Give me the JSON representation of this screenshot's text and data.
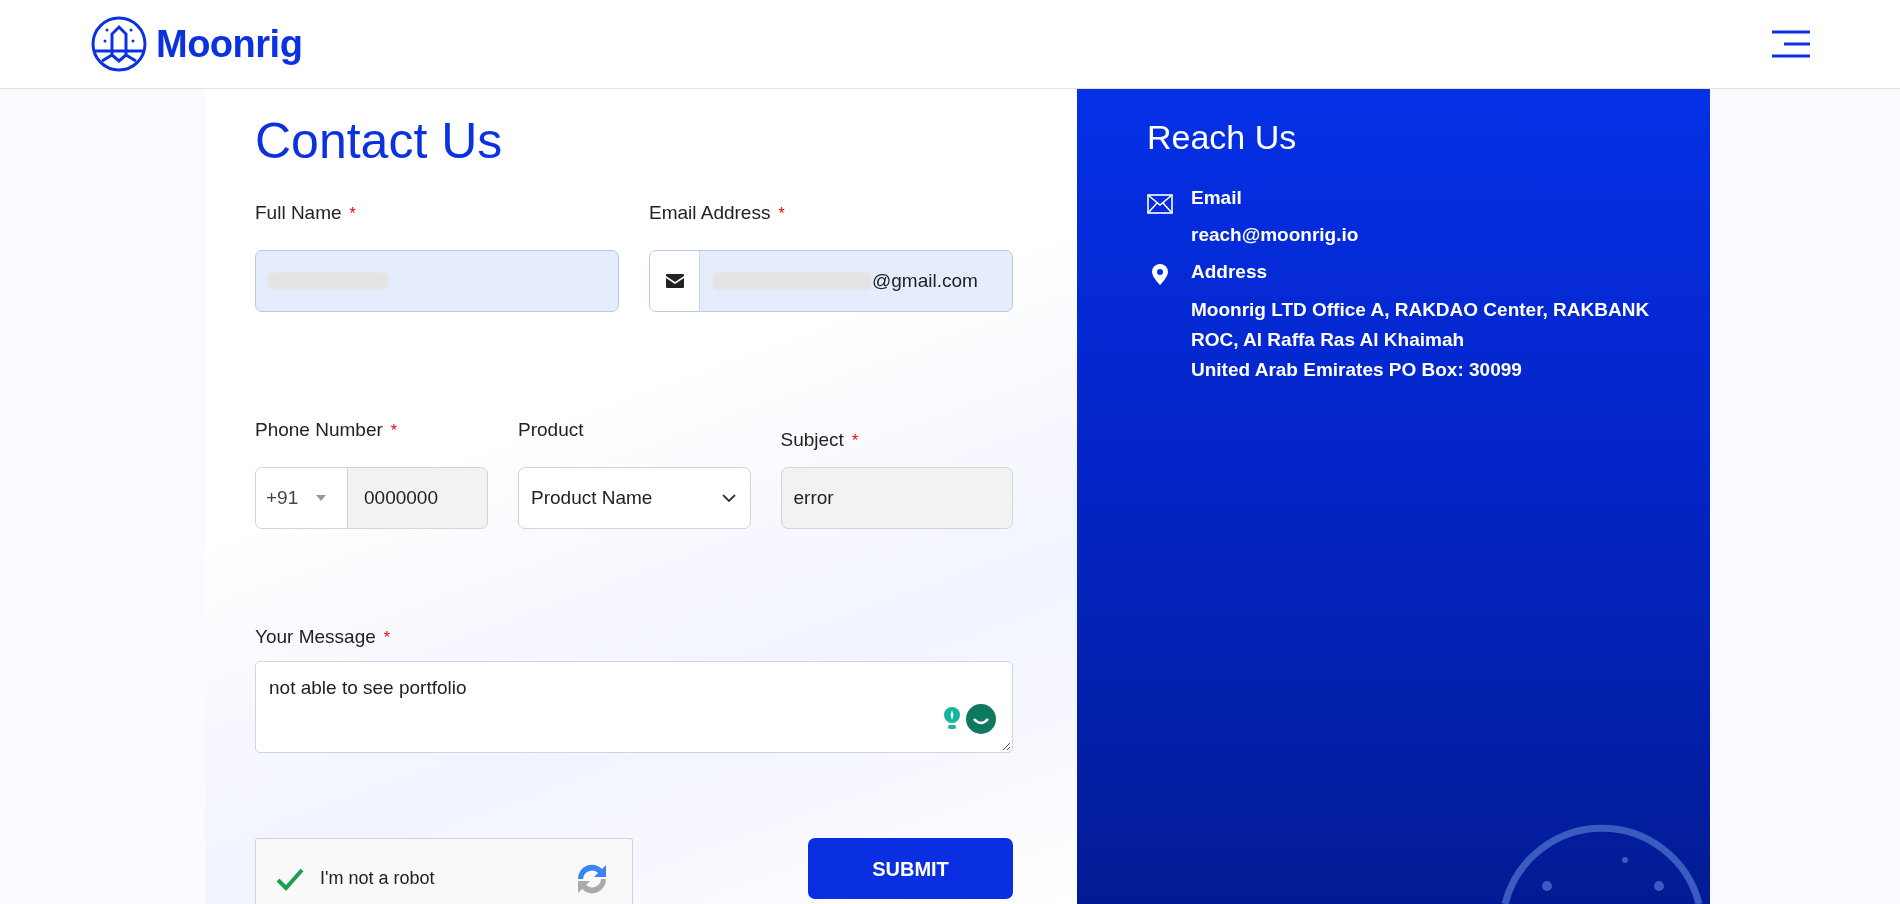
{
  "header": {
    "logo": "Moonrig"
  },
  "form": {
    "title": "Contact Us",
    "rows": [
      {
        "fields": [
          {
            "kind": "text",
            "label": "Full Name",
            "required_mark": "*",
            "autofilled": true,
            "redacted": true
          },
          {
            "kind": "email",
            "label": "Email Address",
            "required_mark": "*",
            "autofilled": true,
            "redacted": true,
            "value": "@gmail.com"
          }
        ]
      },
      {
        "fields": [
          {
            "kind": "phone",
            "label": "Phone Number",
            "required_mark": "*",
            "autofilled": false,
            "country_code": "+91",
            "value": "0000000"
          },
          {
            "kind": "select",
            "label": "Product",
            "value": "Product Name"
          },
          {
            "kind": "text",
            "label": "Subject",
            "required_mark": "*",
            "autofilled": false,
            "value": "error"
          }
        ]
      },
      {
        "fields": [
          {
            "kind": "textarea",
            "label": "Your Message",
            "required_mark": "*",
            "value": "not able to see portfolio"
          }
        ]
      }
    ],
    "captcha": {
      "label": "I'm not a robot",
      "checked": true
    },
    "submit": "SUBMIT"
  },
  "contact": {
    "title": "Reach Us",
    "items": [
      {
        "kind": "email",
        "label": "Email",
        "lines": [
          "reach@moonrig.io"
        ]
      },
      {
        "kind": "address",
        "label": "Address",
        "lines": [
          "Moonrig LTD Office A, RAKDAO Center, RAKBANK",
          "ROC, Al Raffa Ras Al Khaimah",
          "United Arab Emirates PO Box: 30099"
        ]
      }
    ]
  }
}
